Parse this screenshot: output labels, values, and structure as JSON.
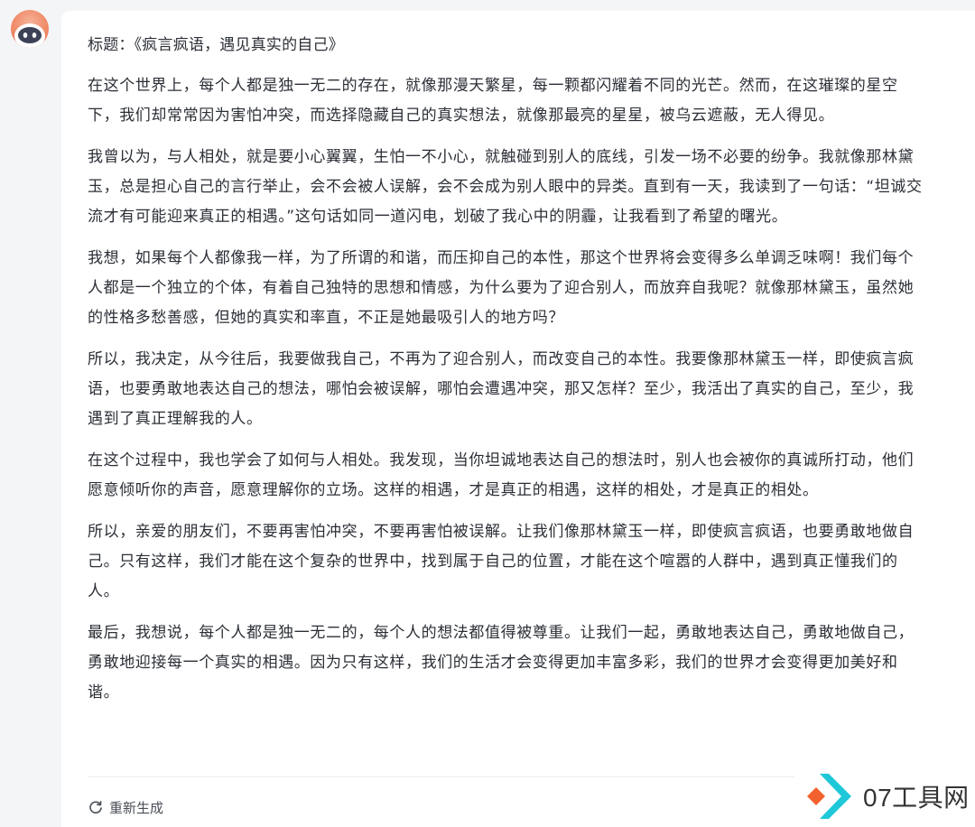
{
  "chat": {
    "title": "标题：《疯言疯语，遇见真实的自己》",
    "paragraphs": [
      "在这个世界上，每个人都是独一无二的存在，就像那漫天繁星，每一颗都闪耀着不同的光芒。然而，在这璀璨的星空下，我们却常常因为害怕冲突，而选择隐藏自己的真实想法，就像那最亮的星星，被乌云遮蔽，无人得见。",
      "我曾以为，与人相处，就是要小心翼翼，生怕一不小心，就触碰到别人的底线，引发一场不必要的纷争。我就像那林黛玉，总是担心自己的言行举止，会不会被人误解，会不会成为别人眼中的异类。直到有一天，我读到了一句话：“坦诚交流才有可能迎来真正的相遇。”这句话如同一道闪电，划破了我心中的阴霾，让我看到了希望的曙光。",
      "我想，如果每个人都像我一样，为了所谓的和谐，而压抑自己的本性，那这个世界将会变得多么单调乏味啊！我们每个人都是一个独立的个体，有着自己独特的思想和情感，为什么要为了迎合别人，而放弃自我呢？就像那林黛玉，虽然她的性格多愁善感，但她的真实和率直，不正是她最吸引人的地方吗？",
      "所以，我决定，从今往后，我要做我自己，不再为了迎合别人，而改变自己的本性。我要像那林黛玉一样，即使疯言疯语，也要勇敢地表达自己的想法，哪怕会被误解，哪怕会遭遇冲突，那又怎样？至少，我活出了真实的自己，至少，我遇到了真正理解我的人。",
      "在这个过程中，我也学会了如何与人相处。我发现，当你坦诚地表达自己的想法时，别人也会被你的真诚所打动，他们愿意倾听你的声音，愿意理解你的立场。这样的相遇，才是真正的相遇，这样的相处，才是真正的相处。",
      "所以，亲爱的朋友们，不要再害怕冲突，不要再害怕被误解。让我们像那林黛玉一样，即使疯言疯语，也要勇敢地做自己。只有这样，我们才能在这个复杂的世界中，找到属于自己的位置，才能在这个喧嚣的人群中，遇到真正懂我们的人。",
      "最后，我想说，每个人都是独一无二的，每个人的想法都值得被尊重。让我们一起，勇敢地表达自己，勇敢地做自己，勇敢地迎接每一个真实的相遇。因为只有这样，我们的生活才会变得更加丰富多彩，我们的世界才会变得更加美好和谐。"
    ],
    "regenerate_label": "重新生成"
  },
  "watermark": {
    "text": "07工具网"
  },
  "icons": {
    "avatar": "robot-avatar-icon",
    "regenerate": "refresh-icon",
    "watermark_logo": "arrow-logo-icon"
  },
  "colors": {
    "background": "#f4f5f7",
    "card": "#ffffff",
    "text": "#2b2f36",
    "avatar_orange": "#f08a67",
    "logo_orange": "#f2622e",
    "logo_cyan": "#1fc8d8"
  }
}
